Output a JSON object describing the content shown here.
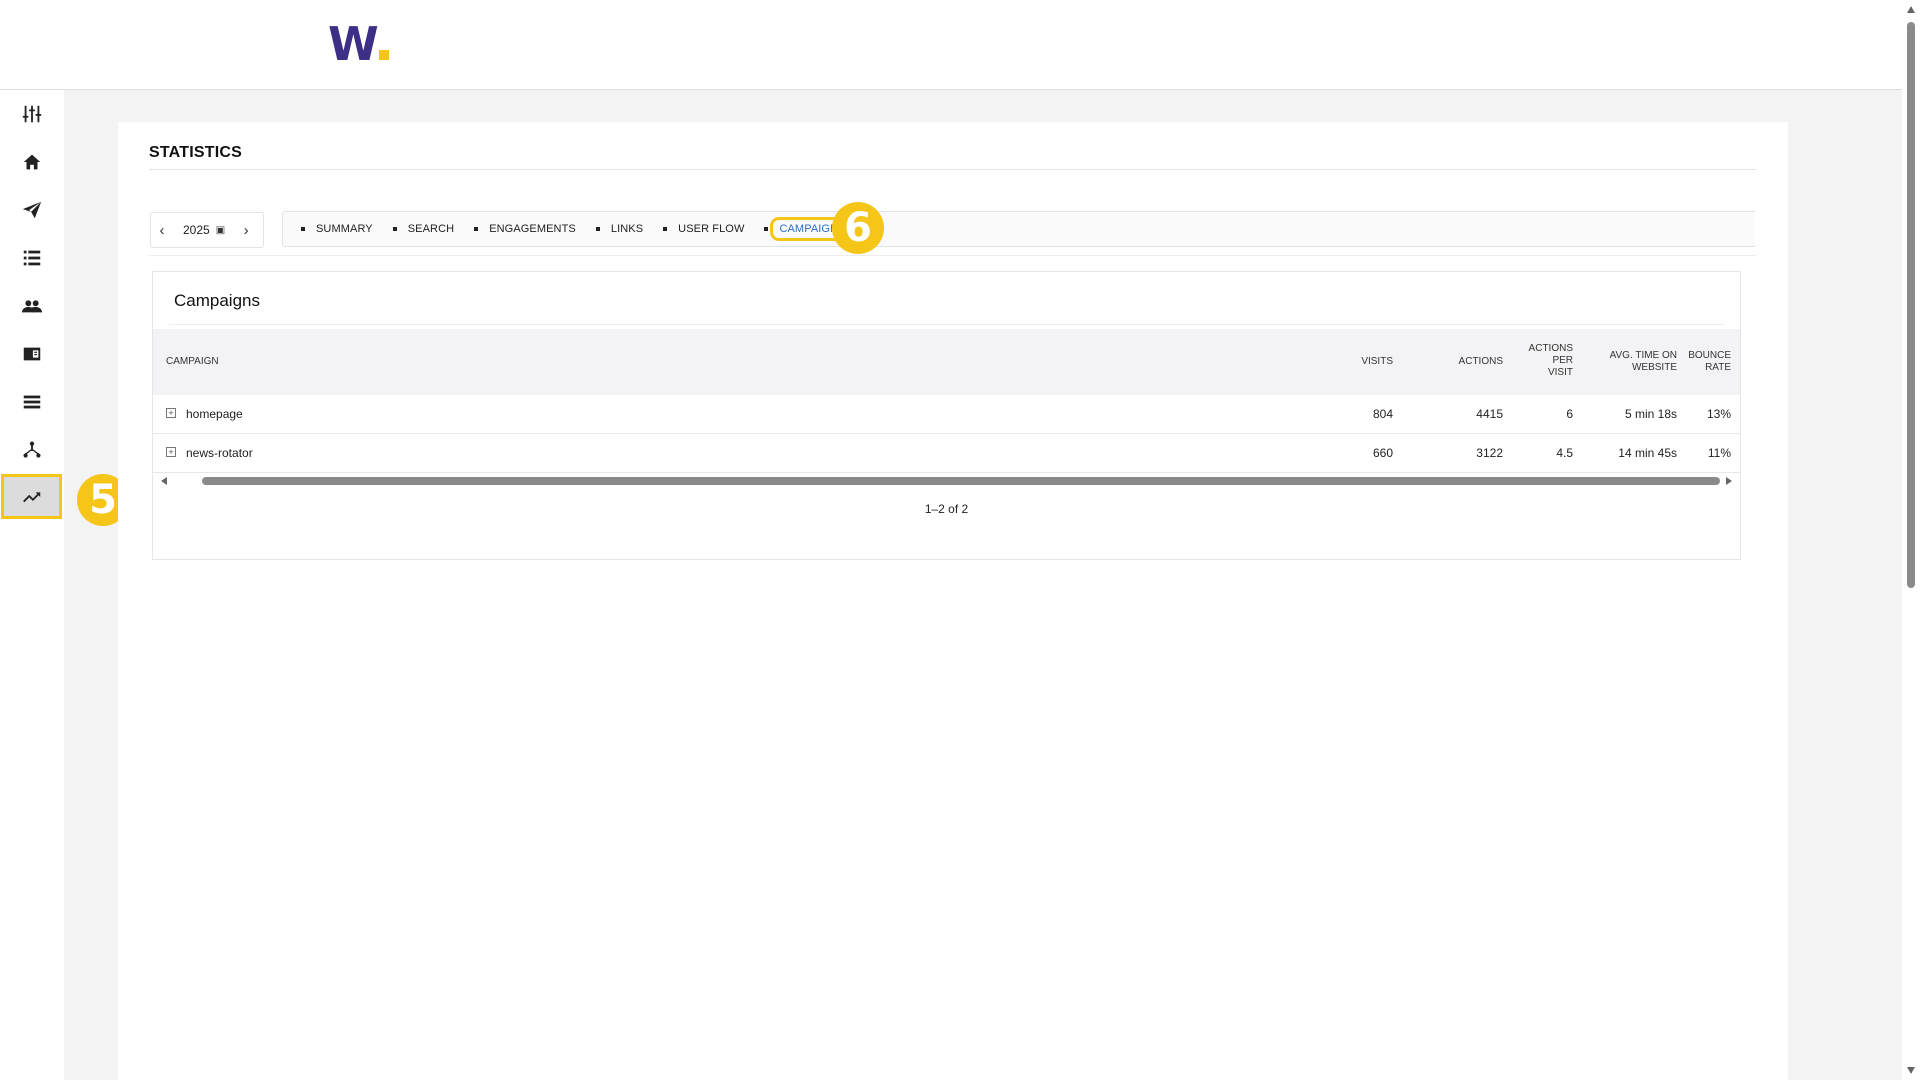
{
  "header": {
    "logo_letter": "W"
  },
  "sidebar": {
    "items": [
      {
        "name": "settings-sliders",
        "icon": "sliders-icon"
      },
      {
        "name": "home",
        "icon": "home-icon"
      },
      {
        "name": "send",
        "icon": "paper-plane-icon"
      },
      {
        "name": "list",
        "icon": "list-icon"
      },
      {
        "name": "people",
        "icon": "people-icon"
      },
      {
        "name": "book",
        "icon": "book-icon"
      },
      {
        "name": "rows",
        "icon": "rows-icon"
      },
      {
        "name": "hierarchy",
        "icon": "hierarchy-icon"
      },
      {
        "name": "statistics",
        "icon": "trending-icon",
        "active": true
      }
    ]
  },
  "annotations": {
    "badge_5": "5",
    "badge_6": "6"
  },
  "page": {
    "title": "STATISTICS"
  },
  "year_picker": {
    "year": "2025",
    "prev": "‹",
    "next": "›",
    "calendar": "▣"
  },
  "tabs": [
    {
      "label": "SUMMARY"
    },
    {
      "label": "SEARCH"
    },
    {
      "label": "ENGAGEMENTS"
    },
    {
      "label": "LINKS"
    },
    {
      "label": "USER FLOW"
    },
    {
      "label": "CAMPAIGNS",
      "active": true
    }
  ],
  "campaigns": {
    "title": "Campaigns",
    "columns": {
      "campaign": "CAMPAIGN",
      "visits": "VISITS",
      "actions": "ACTIONS",
      "actions_per_visit_1": "ACTIONS",
      "actions_per_visit_2": "PER",
      "actions_per_visit_3": "VISIT",
      "avg_time_1": "AVG. TIME ON",
      "avg_time_2": "WEBSITE",
      "bounce_1": "BOUNCE",
      "bounce_2": "RATE"
    },
    "rows": [
      {
        "campaign": "homepage",
        "visits": "804",
        "actions": "4415",
        "actions_per_visit": "6",
        "avg_time": "5 min 18s",
        "bounce_rate": "13%"
      },
      {
        "campaign": "news-rotator",
        "visits": "660",
        "actions": "3122",
        "actions_per_visit": "4.5",
        "avg_time": "14 min 45s",
        "bounce_rate": "11%"
      }
    ],
    "pagination": "1–2 of 2"
  },
  "colors": {
    "accent_yellow": "#f5c518",
    "brand_purple": "#3d2f86",
    "link_blue": "#2a6fc9"
  }
}
